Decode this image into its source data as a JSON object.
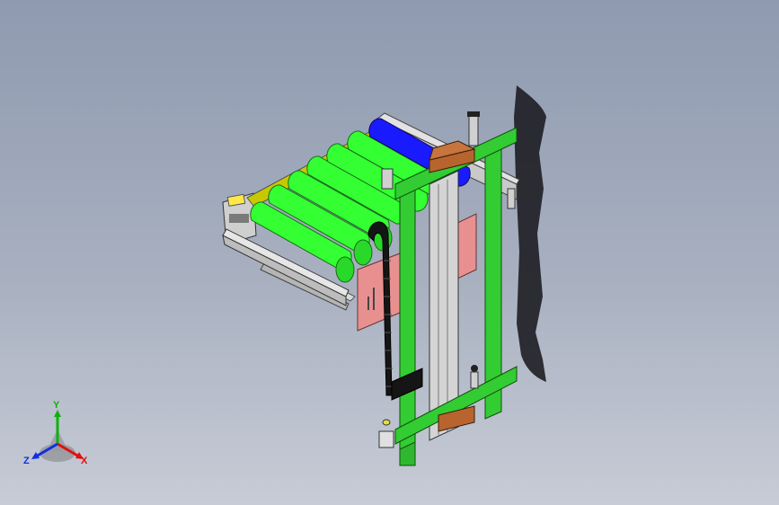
{
  "viewport": {
    "background_top": "#8f9ab0",
    "background_bottom": "#c7ccd6"
  },
  "model": {
    "roller_color": "#33ff33",
    "drive_roller_color": "#1a1aff",
    "frame_color": "#33cc33",
    "side_plate_color": "#e89090",
    "rail_color": "#c8c800",
    "bracket_color": "#b8642e",
    "cable_chain_color": "#151515",
    "roller_count": 6
  },
  "triad": {
    "x_label": "X",
    "y_label": "Y",
    "z_label": "Z",
    "x_color": "#e01010",
    "y_color": "#10b010",
    "z_color": "#1030e0"
  }
}
